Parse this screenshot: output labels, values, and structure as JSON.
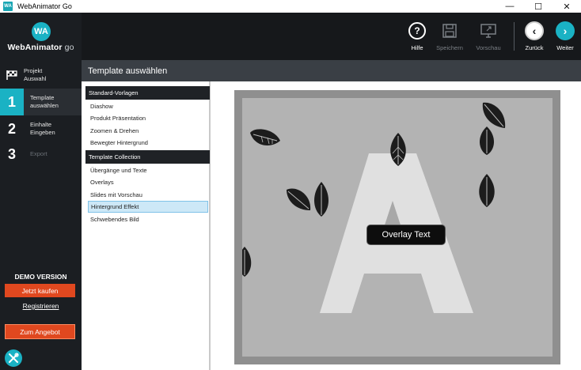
{
  "window": {
    "title": "WebAnimator Go",
    "icon_text": "WA",
    "controls": [
      "—",
      "☐",
      "✕"
    ]
  },
  "logo": {
    "mark": "WA",
    "name_bold": "WebAnimator",
    "name_light": " go"
  },
  "steps": [
    {
      "num": "",
      "label_line1": "Projekt",
      "label_line2": "Auswahl",
      "icon": "flag-icon"
    },
    {
      "num": "1",
      "label_line1": "Template",
      "label_line2": "auswählen"
    },
    {
      "num": "2",
      "label_line1": "Einhalte",
      "label_line2": "Eingeben"
    },
    {
      "num": "3",
      "label_line1": "Export",
      "label_line2": ""
    }
  ],
  "sidebar_bottom": {
    "demo": "DEMO VERSION",
    "buy": "Jetzt kaufen",
    "register": "Registrieren",
    "offer": "Zum Angebot"
  },
  "toolbar": {
    "help": "Hilfe",
    "save": "Speichern",
    "preview": "Vorschau",
    "back": "Zurück",
    "next": "Weiter",
    "help_icon_glyph": "?",
    "back_glyph": "‹",
    "next_glyph": "›"
  },
  "section": {
    "title": "Template auswählen"
  },
  "templates": {
    "group1": {
      "header": "Standard-Vorlagen",
      "items": [
        "Diashow",
        "Produkt Präsentation",
        "Zoomen & Drehen",
        "Bewegter Hintergrund"
      ]
    },
    "group2": {
      "header": "Template Collection",
      "items": [
        "Übergänge und Texte",
        "Overlays",
        "Slides mit Vorschau",
        "Hintergrund Effekt",
        "Schwebendes Bild"
      ]
    },
    "selected": "Hintergrund Effekt"
  },
  "preview": {
    "overlay_text": "Overlay Text",
    "big_letter": "A"
  },
  "colors": {
    "accent": "#1ab2c4",
    "orange": "#e0481f",
    "sidebar": "#1b1e22",
    "toolbar": "#16181b",
    "section_header": "#3a3f45",
    "selected_item": "#cde8f7"
  }
}
